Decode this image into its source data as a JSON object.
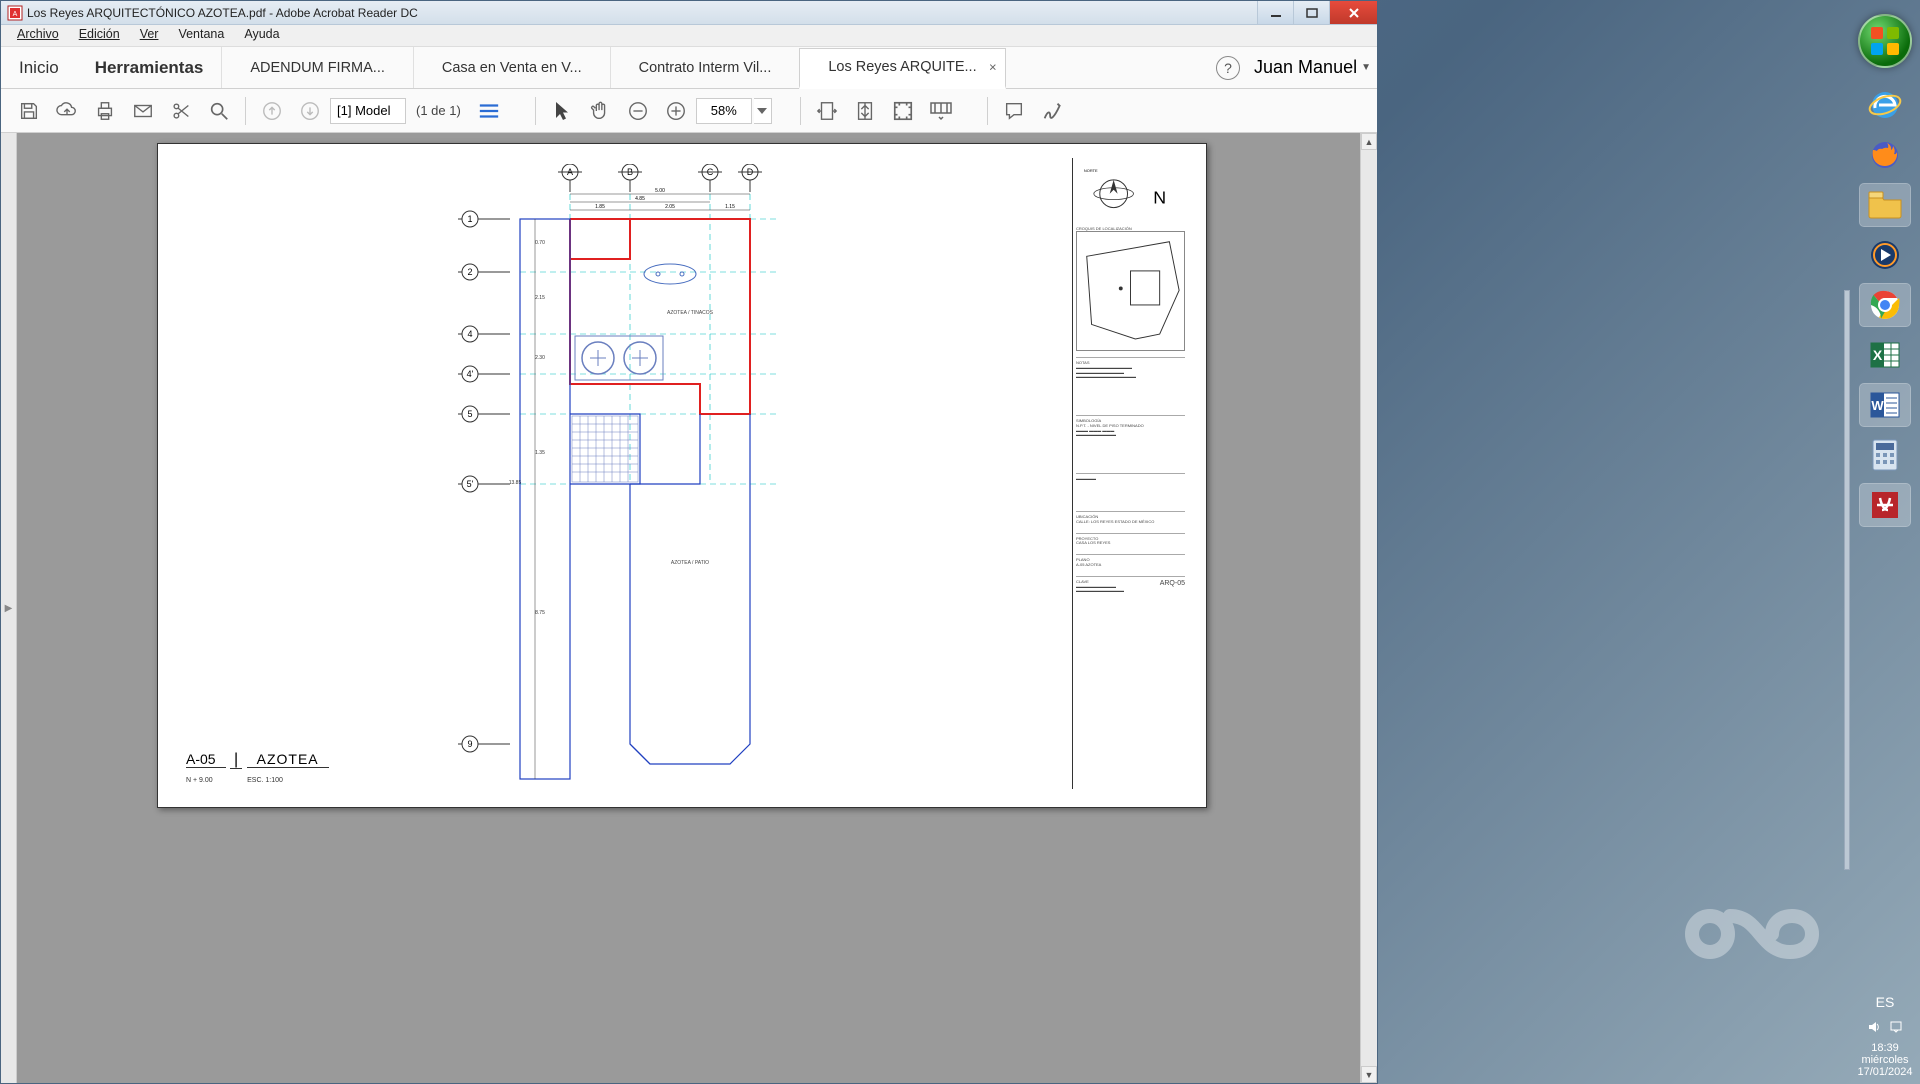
{
  "window": {
    "title": "Los Reyes ARQUITECTÓNICO AZOTEA.pdf - Adobe Acrobat Reader DC"
  },
  "menu": {
    "archivo": "Archivo",
    "edicion": "Edición",
    "ver": "Ver",
    "ventana": "Ventana",
    "ayuda": "Ayuda"
  },
  "tabs": {
    "inicio": "Inicio",
    "herramientas": "Herramientas",
    "docs": [
      {
        "label": "ADENDUM FIRMA...",
        "active": false
      },
      {
        "label": "Casa en Venta en V...",
        "active": false
      },
      {
        "label": "Contrato Interm Vil...",
        "active": false
      },
      {
        "label": "Los Reyes ARQUITE...",
        "active": true
      }
    ]
  },
  "user": {
    "name": "Juan Manuel"
  },
  "toolbar": {
    "page_label": "[1] Model",
    "page_count": "(1 de 1)",
    "zoom": "58%"
  },
  "plan": {
    "sheet_id": "A-05",
    "sheet_name": "AZOTEA",
    "level": "N + 9.00",
    "scale": "ESC. 1:100",
    "north_label": "N",
    "axes_h": [
      "A",
      "B",
      "C",
      "D"
    ],
    "axes_v": [
      "1",
      "2",
      "4",
      "4'",
      "5",
      "5'",
      "9"
    ],
    "dims_top": {
      "total": "5.00",
      "left": "4.85",
      "mid": "2.05",
      "right": "1.15",
      "far_left": "1.85"
    },
    "dims_left": {
      "seg1": "0.70",
      "seg2": "2.15",
      "seg3": "2.30",
      "seg4": "1.35",
      "seg5": "13.85",
      "seg6": "8.75"
    },
    "rooms": {
      "azotea_tinacos": "AZOTEA / TINACOS",
      "azotea_patio": "AZOTEA / PATIO"
    },
    "legend": {
      "norte": "NORTE",
      "croquis": "CROQUIS DE LOCALIZACIÓN",
      "notas": "NOTAS",
      "simbologia": "SIMBOLOGÍA",
      "npt": "N.P.T. - NIVEL DE PISO TERMINADO",
      "ubicacion": "UBICACIÓN",
      "ubicacion_val": "CALLE:     LOS REYES ESTADO DE MÉXICO",
      "proyecto": "PROYECTO",
      "proyecto_val": "CASA LOS REYES",
      "plano": "PLANO",
      "plano_val": "A-05 AZOTEA",
      "clave": "CLAVE",
      "clave_val": "ARQ-05"
    }
  },
  "systray": {
    "lang": "ES",
    "time": "18:39",
    "day": "miércoles",
    "date": "17/01/2024"
  },
  "taskbar_icons": [
    "start-orb",
    "internet-explorer",
    "firefox",
    "file-explorer",
    "media-player",
    "chrome",
    "excel",
    "word",
    "calculator",
    "acrobat"
  ]
}
